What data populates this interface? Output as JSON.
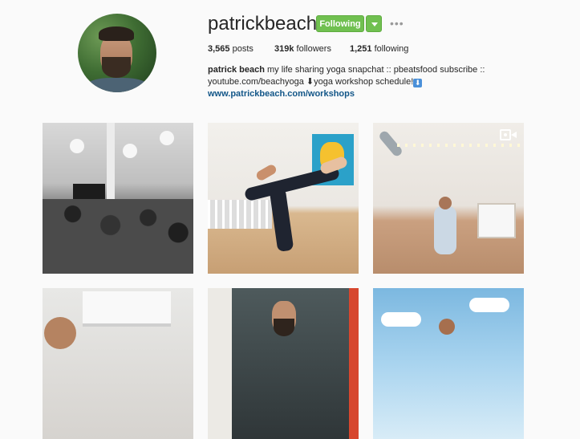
{
  "profile": {
    "username": "patrickbeach",
    "follow_button_label": "Following",
    "dropdown_icon": "caret-down-icon",
    "options_label": "•••",
    "stats": {
      "posts_count": "3,565",
      "posts_label": "posts",
      "followers_count": "319k",
      "followers_label": "followers",
      "following_count": "1,251",
      "following_label": "following"
    },
    "bio": {
      "name": "patrick beach",
      "line1_text": " my life sharing yoga snapchat :: pbeatsfood subscribe ::",
      "line2_text": "youtube.com/beachyoga ⬇yoga workshop schedule!",
      "line2_emoji": "⬇",
      "link": "www.patrickbeach.com/workshops"
    }
  },
  "grid": {
    "tiles": [
      {
        "kind": "photo",
        "subject": "yoga class in studio"
      },
      {
        "kind": "photo",
        "subject": "partner acro yoga"
      },
      {
        "kind": "video",
        "subject": "seated yoga pose",
        "badge_icon": "video-camera-icon"
      },
      {
        "kind": "photo",
        "subject": "portrait near window"
      },
      {
        "kind": "photo",
        "subject": "portrait"
      },
      {
        "kind": "photo",
        "subject": "outdoor sky"
      }
    ]
  },
  "colors": {
    "follow_green": "#70c050",
    "link_blue": "#125688",
    "background": "#fafafa"
  }
}
